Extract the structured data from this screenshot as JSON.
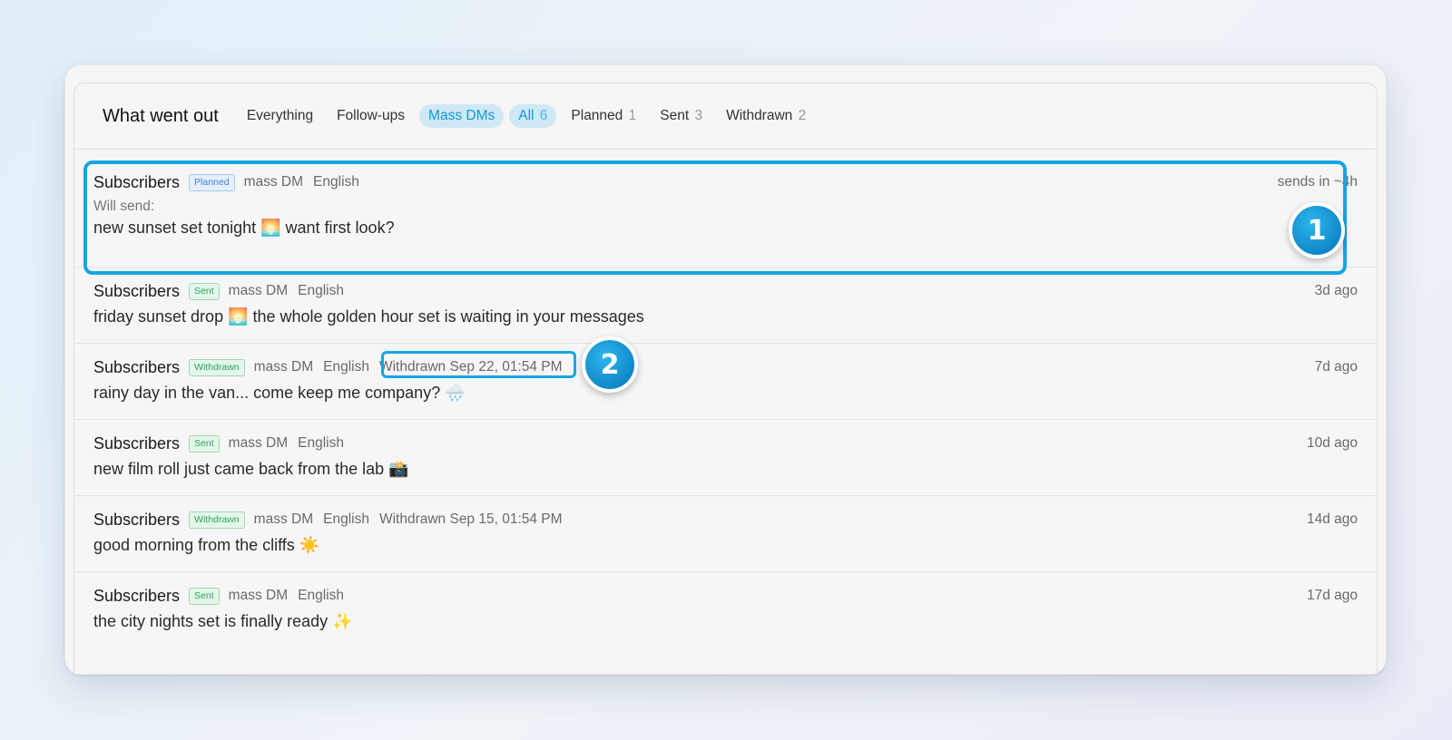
{
  "header": {
    "title": "What went out",
    "tabs": [
      {
        "label": "Everything",
        "count": "",
        "active": false
      },
      {
        "label": "Follow-ups",
        "count": "",
        "active": false
      },
      {
        "label": "Mass DMs",
        "count": "",
        "active": true
      }
    ],
    "filters": [
      {
        "label": "All",
        "count": "6",
        "active": true
      },
      {
        "label": "Planned",
        "count": "1",
        "active": false
      },
      {
        "label": "Sent",
        "count": "3",
        "active": false
      },
      {
        "label": "Withdrawn",
        "count": "2",
        "active": false
      }
    ]
  },
  "rows": [
    {
      "audience": "Subscribers",
      "status": "Planned",
      "type": "mass DM",
      "language": "English",
      "withdrawn_at": "",
      "time": "sends in ~4h",
      "preview_label": "Will send:",
      "message": "new sunset set tonight 🌅 want first look?"
    },
    {
      "audience": "Subscribers",
      "status": "Sent",
      "type": "mass DM",
      "language": "English",
      "withdrawn_at": "",
      "time": "3d ago",
      "preview_label": "",
      "message": "friday sunset drop 🌅 the whole golden hour set is waiting in your messages"
    },
    {
      "audience": "Subscribers",
      "status": "Withdrawn",
      "type": "mass DM",
      "language": "English",
      "withdrawn_at": "Withdrawn Sep 22, 01:54 PM",
      "time": "7d ago",
      "preview_label": "",
      "message": "rainy day in the van... come keep me company? 🌧️"
    },
    {
      "audience": "Subscribers",
      "status": "Sent",
      "type": "mass DM",
      "language": "English",
      "withdrawn_at": "",
      "time": "10d ago",
      "preview_label": "",
      "message": "new film roll just came back from the lab 📸"
    },
    {
      "audience": "Subscribers",
      "status": "Withdrawn",
      "type": "mass DM",
      "language": "English",
      "withdrawn_at": "Withdrawn Sep 15, 01:54 PM",
      "time": "14d ago",
      "preview_label": "",
      "message": "good morning from the cliffs ☀️"
    },
    {
      "audience": "Subscribers",
      "status": "Sent",
      "type": "mass DM",
      "language": "English",
      "withdrawn_at": "",
      "time": "17d ago",
      "preview_label": "",
      "message": "the city nights set is finally ready ✨"
    }
  ],
  "markers": [
    "1",
    "2"
  ],
  "colors": {
    "accent": "#14a6e3",
    "active_tab_bg": "#cfe8f6",
    "sent": "#2aa55a",
    "planned": "#3d7fd6"
  }
}
